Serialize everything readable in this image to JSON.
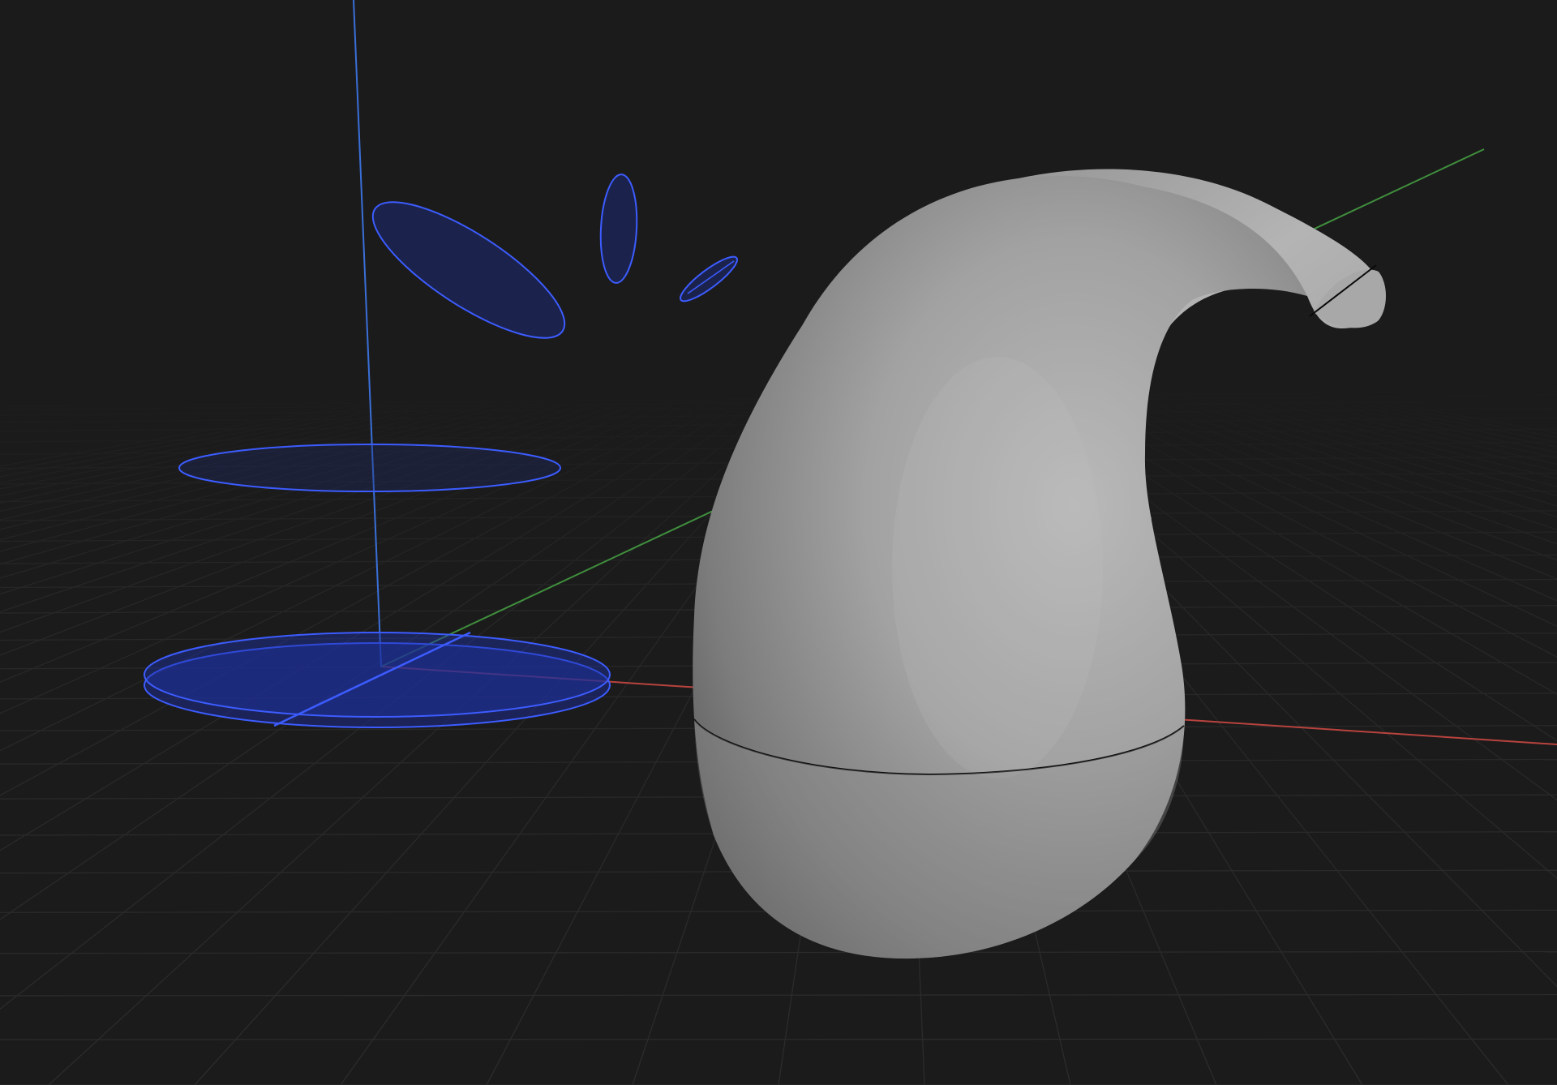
{
  "app": {
    "view": "3D viewport"
  },
  "viewport": {
    "background_color": "#1b1b1b",
    "grid_color": "#2c2c2c",
    "axis_colors": {
      "x": "#b8433e",
      "y": "#3f8f3d",
      "z": "#3a6fd8"
    },
    "profile_curve_color": "#3c5cff",
    "profile_fill_color": "#1c2a6e",
    "model_color": "#9a9a9a",
    "seam_line_color": "#0a0a0a"
  },
  "scene": {
    "model": "teardrop-hook-solid",
    "profile_sections_count": 6,
    "grid": true
  }
}
